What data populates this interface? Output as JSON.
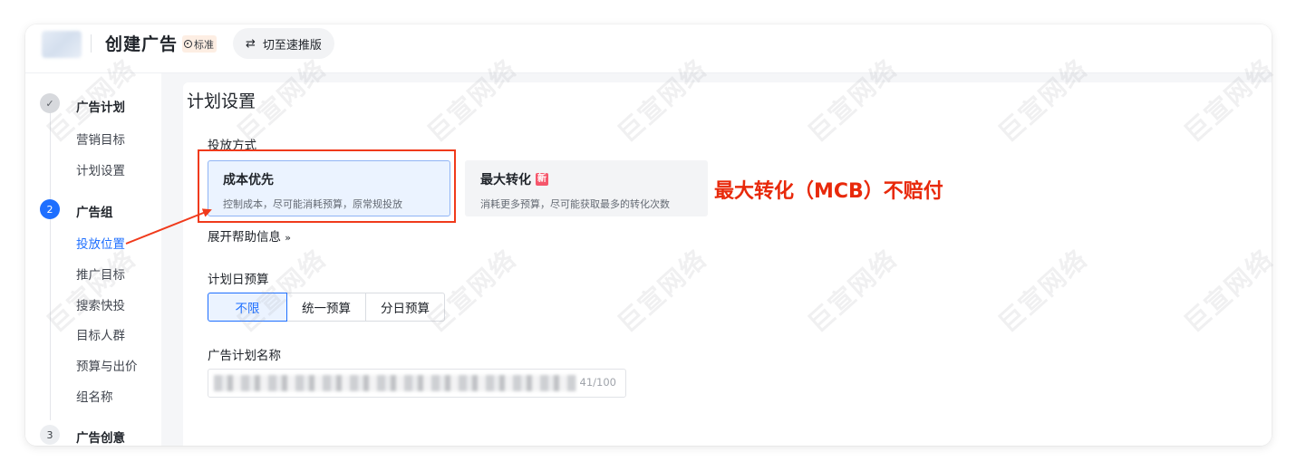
{
  "header": {
    "title": "创建广告",
    "mode_badge": "标准",
    "switch_label": "切至速推版",
    "switch_icon": "swap-icon"
  },
  "sidebar": {
    "steps": [
      {
        "number": "1",
        "status": "done",
        "title": "广告计划",
        "items": [
          "营销目标",
          "计划设置"
        ]
      },
      {
        "number": "2",
        "status": "active",
        "title": "广告组",
        "items": [
          "投放位置",
          "推广目标",
          "搜索快投",
          "目标人群",
          "预算与出价",
          "组名称"
        ],
        "active_item": "投放位置"
      },
      {
        "number": "3",
        "status": "todo",
        "title": "广告创意",
        "items": []
      }
    ]
  },
  "main": {
    "section_title": "计划设置",
    "delivery": {
      "label": "投放方式",
      "options": [
        {
          "title": "成本优先",
          "desc": "控制成本，尽可能消耗预算，原常规投放",
          "selected": true
        },
        {
          "title": "最大转化",
          "badge": "新",
          "desc": "消耗更多预算，尽可能获取最多的转化次数",
          "selected": false
        }
      ],
      "expand_label": "展开帮助信息",
      "expand_icon": "double-chevron-down-icon"
    },
    "budget": {
      "label": "计划日预算",
      "options": [
        "不限",
        "统一预算",
        "分日预算"
      ],
      "selected": "不限"
    },
    "plan_name": {
      "label": "广告计划名称",
      "counter": "41/100"
    }
  },
  "annotation": {
    "text": "最大转化（MCB）不赔付",
    "color": "#e8290b"
  },
  "watermark": "巨宣网络",
  "colors": {
    "accent": "#1e6fff",
    "annotation_red": "#f03a1b"
  }
}
